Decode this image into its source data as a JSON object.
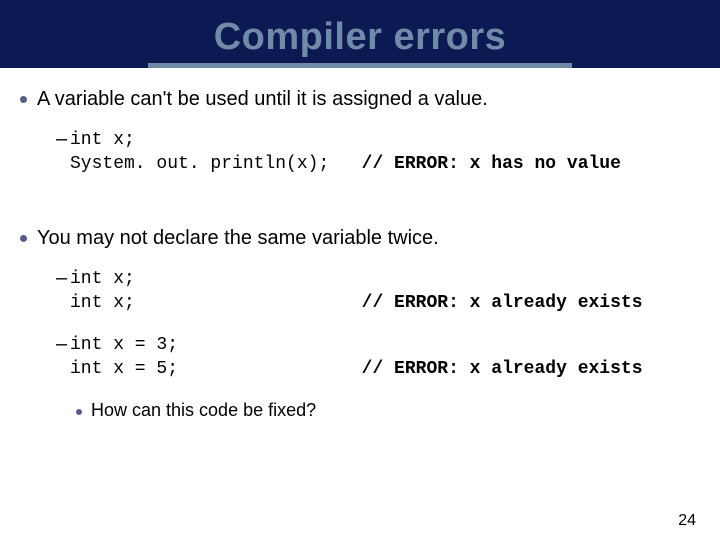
{
  "title": "Compiler errors",
  "bullet_a": "A variable can't be used until it is assigned a value.",
  "code_a_l1_left": "int x;",
  "code_a_l2_left": "System. out. println(x);   ",
  "code_a_l2_cmt": "// ERROR: x has no value",
  "bullet_b": "You may not declare the same variable twice.",
  "code_b1_l1_left": "int x;",
  "code_b1_l2_left": "int x;                     ",
  "code_b1_l2_cmt": "// ERROR: x already exists",
  "code_b2_l1_left": "int x = 3;",
  "code_b2_l2_left": "int x = 5;                 ",
  "code_b2_l2_cmt": "// ERROR: x already exists",
  "sub_bullet": "How can this code be fixed?",
  "page_number": "24"
}
